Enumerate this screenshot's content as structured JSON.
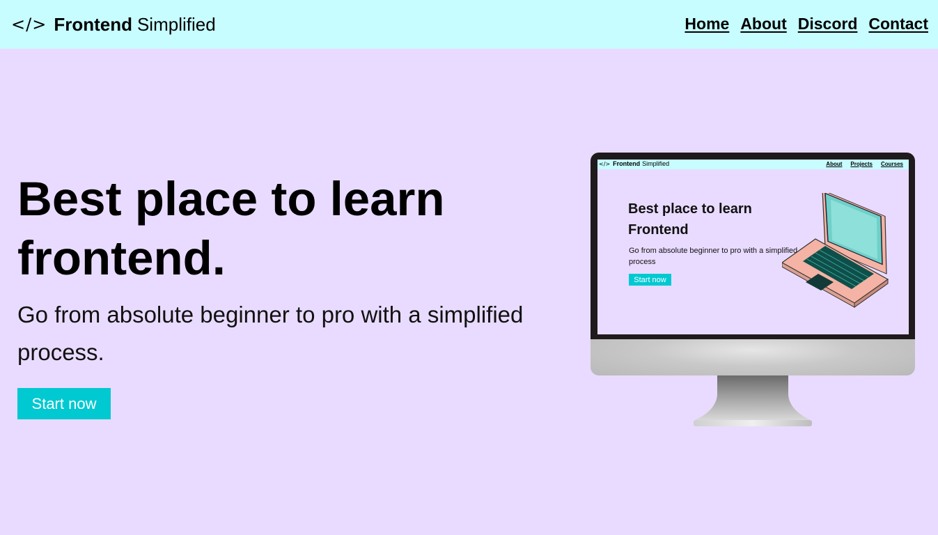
{
  "nav": {
    "logo_glyph": "</>",
    "logo_bold": "Frontend",
    "logo_light": "Simplified",
    "links": [
      {
        "label": "Home"
      },
      {
        "label": "About"
      },
      {
        "label": "Discord"
      },
      {
        "label": "Contact"
      }
    ]
  },
  "hero": {
    "title": "Best place to learn frontend.",
    "subtitle": "Go from absolute beginner to pro with a simplified process.",
    "cta_label": "Start now"
  },
  "illustration": {
    "mini_logo_glyph": "</>",
    "mini_logo_bold": "Frontend",
    "mini_logo_light": "Simplified",
    "mini_links": [
      "About",
      "Projects",
      "Courses"
    ],
    "mini_title": "Best place to learn Frontend",
    "mini_subtitle": "Go from absolute beginner to pro with a simplified process",
    "mini_cta": "Start now"
  },
  "colors": {
    "nav_bg": "#c7fdff",
    "page_bg": "#e9dbff",
    "accent": "#00c9d1",
    "text": "#000000"
  },
  "icons": {
    "logo": "code-brackets-icon",
    "illustration": "desktop-monitor-icon"
  }
}
